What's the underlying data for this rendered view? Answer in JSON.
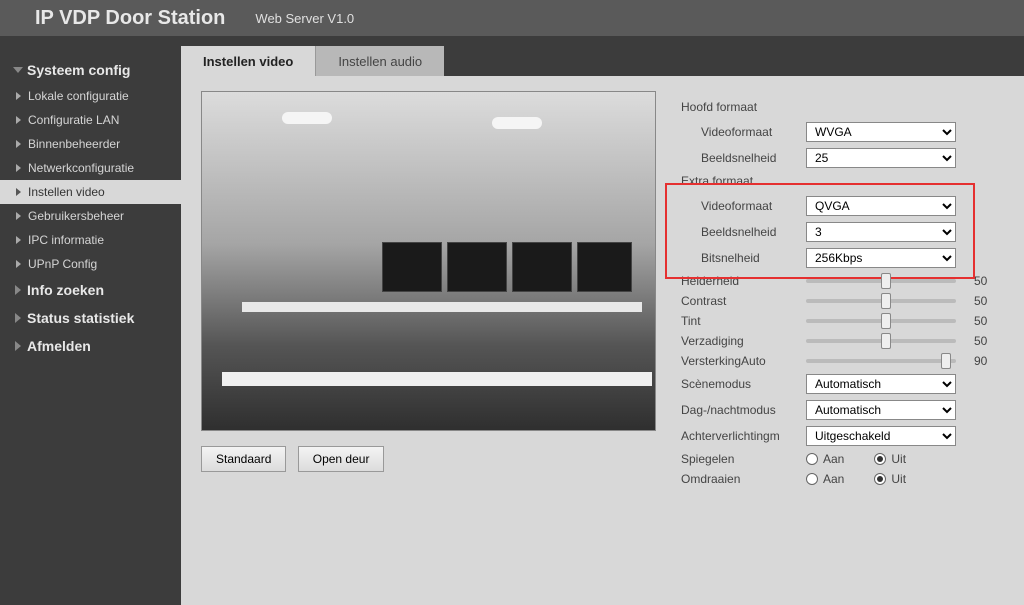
{
  "header": {
    "title": "IP VDP Door Station",
    "subtitle": "Web Server V1.0"
  },
  "sidebar": {
    "groups": [
      {
        "label": "Systeem config",
        "items": [
          "Lokale configuratie",
          "Configuratie LAN",
          "Binnenbeheerder",
          "Netwerkconfiguratie",
          "Instellen video",
          "Gebruikersbeheer",
          "IPC informatie",
          "UPnP Config"
        ],
        "activeIndex": 4
      },
      {
        "label": "Info zoeken"
      },
      {
        "label": "Status statistiek"
      },
      {
        "label": "Afmelden"
      }
    ]
  },
  "tabs": {
    "active": "Instellen video",
    "inactive": "Instellen audio"
  },
  "buttons": {
    "default": "Standaard",
    "open": "Open deur"
  },
  "main_format": {
    "title": "Hoofd formaat",
    "videoformat_label": "Videoformaat",
    "videoformat_value": "WVGA",
    "framerate_label": "Beeldsnelheid",
    "framerate_value": "25"
  },
  "extra_format": {
    "title": "Extra formaat",
    "videoformat_label": "Videoformaat",
    "videoformat_value": "QVGA",
    "framerate_label": "Beeldsnelheid",
    "framerate_value": "3",
    "bitrate_label": "Bitsnelheid",
    "bitrate_value": "256Kbps"
  },
  "sliders": {
    "brightness": {
      "label": "Helderheid",
      "value": "50",
      "pos": 50
    },
    "contrast": {
      "label": "Contrast",
      "value": "50",
      "pos": 50
    },
    "tint": {
      "label": "Tint",
      "value": "50",
      "pos": 50
    },
    "saturation": {
      "label": "Verzadiging",
      "value": "50",
      "pos": 50
    },
    "gainauto": {
      "label": "VersterkingAuto",
      "value": "90",
      "pos": 90
    }
  },
  "selects": {
    "scene": {
      "label": "Scènemodus",
      "value": "Automatisch"
    },
    "daynight": {
      "label": "Dag-/nachtmodus",
      "value": "Automatisch"
    },
    "backlight": {
      "label": "Achterverlichtingm",
      "value": "Uitgeschakeld"
    }
  },
  "radios": {
    "mirror": {
      "label": "Spiegelen",
      "on": "Aan",
      "off": "Uit",
      "value": "Uit"
    },
    "flip": {
      "label": "Omdraaien",
      "on": "Aan",
      "off": "Uit",
      "value": "Uit"
    }
  }
}
